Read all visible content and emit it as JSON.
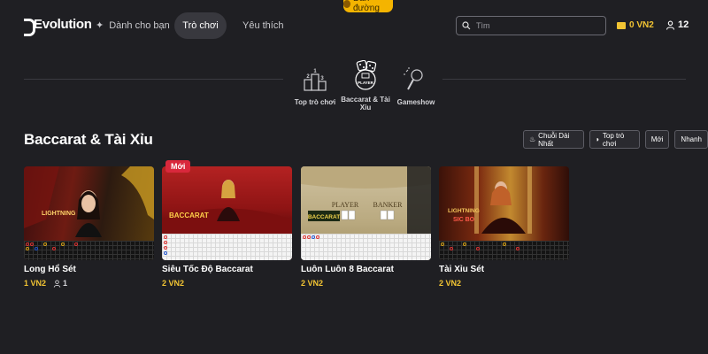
{
  "header": {
    "logo": "Evolution",
    "nav": [
      {
        "label": "Dành cho bạn"
      },
      {
        "label": "Trò chơi"
      },
      {
        "label": "Yêu thích"
      }
    ],
    "guide_label": "Dẫn đường",
    "search_placeholder": "Tìm",
    "balance": "0 VN2",
    "player_count": "12"
  },
  "categories": [
    {
      "label": "Top trò chơi",
      "icon": "podium-icon"
    },
    {
      "label": "Baccarat & Tài Xỉu",
      "icon": "dice-icon",
      "active": true,
      "icon_text": "PLAYER"
    },
    {
      "label": "Gameshow",
      "icon": "microphone-icon"
    }
  ],
  "section": {
    "title": "Baccarat & Tài Xỉu",
    "filters": [
      {
        "label": "Chuỗi Dài Nhất",
        "icon": "fire-icon"
      },
      {
        "label": "Top trò chơi",
        "icon": "play-icon"
      },
      {
        "label": "Mới"
      },
      {
        "label": "Nhanh"
      }
    ]
  },
  "games": [
    {
      "name": "Long Hổ Sét",
      "price": "1 VN2",
      "players": "1",
      "badge": "",
      "art_text": "LIGHTNING"
    },
    {
      "name": "Siêu Tốc Độ Baccarat",
      "price": "2 VN2",
      "players": "",
      "badge": "Mới",
      "art_text": "BACCARAT"
    },
    {
      "name": "Luôn Luôn 8 Baccarat",
      "price": "2 VN2",
      "players": "",
      "badge": "",
      "art_text": "BACCARAT",
      "art_player": "PLAYER",
      "art_banker": "BANKER"
    },
    {
      "name": "Tài Xỉu Sét",
      "price": "2 VN2",
      "players": "",
      "badge": "",
      "art_text": "LIGHTNING",
      "art_sub": "SIC BO"
    }
  ],
  "colors": {
    "background": "#1f1f23",
    "accent_gold": "#f2c433",
    "badge_red": "#d9283c"
  }
}
